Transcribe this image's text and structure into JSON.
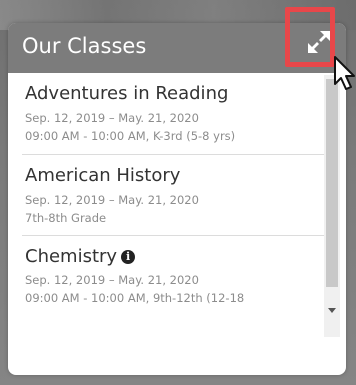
{
  "widget": {
    "title": "Our Classes"
  },
  "icons": {
    "expand": "expand-icon",
    "cursor": "mouse-pointer-icon",
    "info": "info-circle-icon"
  },
  "colors": {
    "header_bg": "#7c7c7c",
    "highlight_box": "#e8474a",
    "class_name": "#333333",
    "class_detail": "#8c8c8c"
  },
  "classes": [
    {
      "name": "Adventures in Reading",
      "dates": "Sep. 12, 2019 – May. 21, 2020",
      "detail": "09:00 AM - 10:00 AM, K-3rd (5-8 yrs)",
      "has_info": false
    },
    {
      "name": "American History",
      "dates": "Sep. 12, 2019 – May. 21, 2020",
      "detail": "7th-8th Grade",
      "has_info": false
    },
    {
      "name": "Chemistry",
      "dates": "Sep. 12, 2019 – May. 21, 2020",
      "detail": "09:00 AM - 10:00 AM, 9th-12th (12-18",
      "has_info": true,
      "info_glyph": "i"
    }
  ]
}
